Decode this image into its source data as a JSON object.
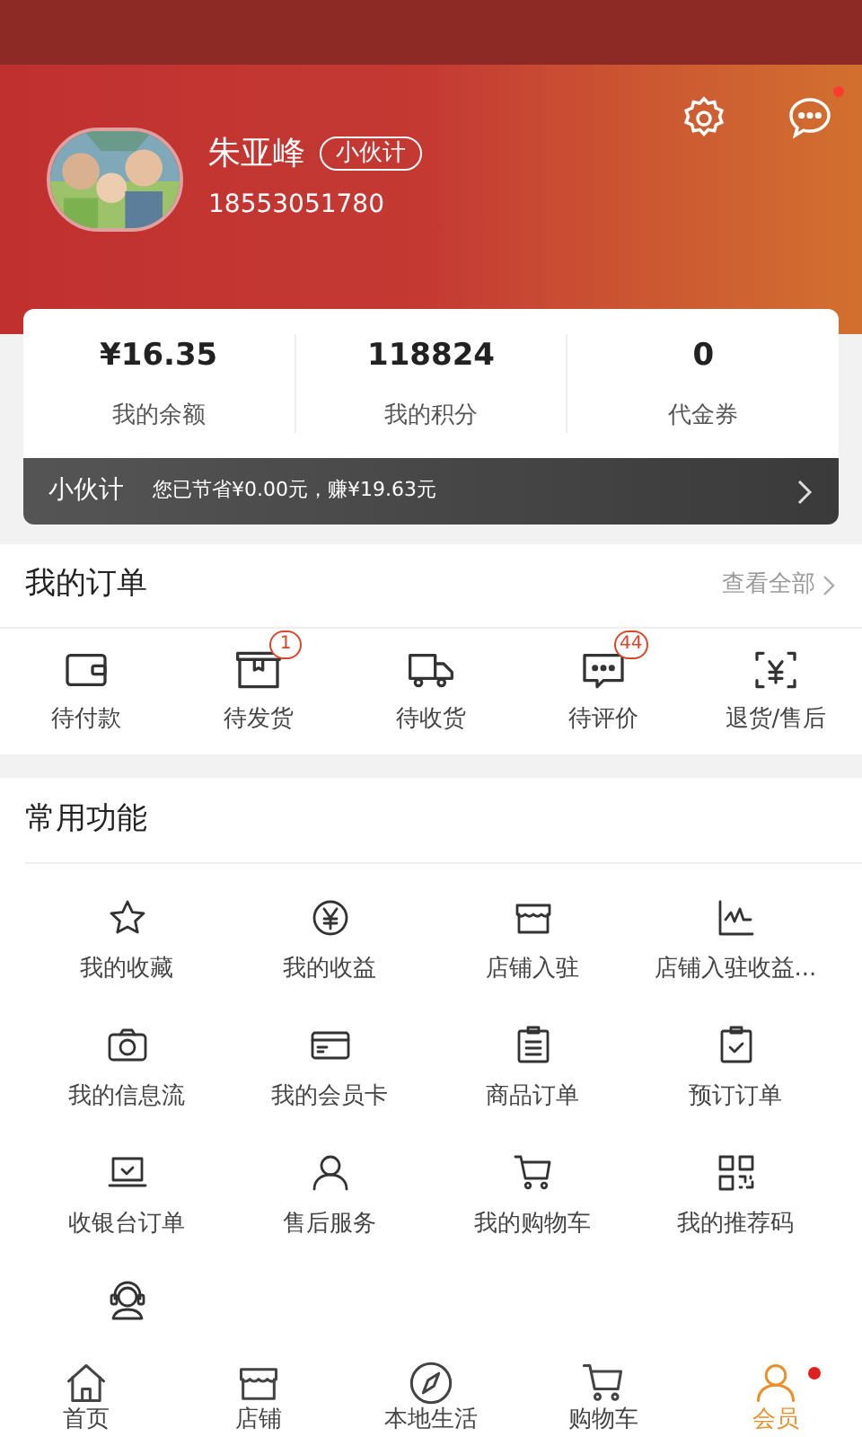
{
  "profile": {
    "name": "朱亚峰",
    "level_badge": "小伙计",
    "phone": "18553051780",
    "messages_unread": true
  },
  "stats": [
    {
      "value": "¥16.35",
      "label": "我的余额"
    },
    {
      "value": "118824",
      "label": "我的积分"
    },
    {
      "value": "0",
      "label": "代金券"
    }
  ],
  "partner_bar": {
    "title": "小伙计",
    "text": "您已节省¥0.00元，赚¥19.63元"
  },
  "orders": {
    "title": "我的订单",
    "view_all": "查看全部",
    "items": [
      {
        "label": "待付款"
      },
      {
        "label": "待发货",
        "badge": "1"
      },
      {
        "label": "待收货"
      },
      {
        "label": "待评价",
        "badge": "44"
      },
      {
        "label": "退货/售后"
      }
    ]
  },
  "functions": {
    "title": "常用功能",
    "items": [
      {
        "label": "我的收藏"
      },
      {
        "label": "我的收益"
      },
      {
        "label": "店铺入驻"
      },
      {
        "label": "店铺入驻收益..."
      },
      {
        "label": "我的信息流"
      },
      {
        "label": "我的会员卡"
      },
      {
        "label": "商品订单"
      },
      {
        "label": "预订订单"
      },
      {
        "label": "收银台订单"
      },
      {
        "label": "售后服务"
      },
      {
        "label": "我的购物车"
      },
      {
        "label": "我的推荐码"
      }
    ]
  },
  "tab_bar": [
    {
      "label": "首页",
      "selected": false,
      "dot": false
    },
    {
      "label": "店铺",
      "selected": false,
      "dot": false
    },
    {
      "label": "本地生活",
      "selected": false,
      "dot": false
    },
    {
      "label": "购物车",
      "selected": false,
      "dot": false
    },
    {
      "label": "会员",
      "selected": true,
      "dot": true
    }
  ]
}
